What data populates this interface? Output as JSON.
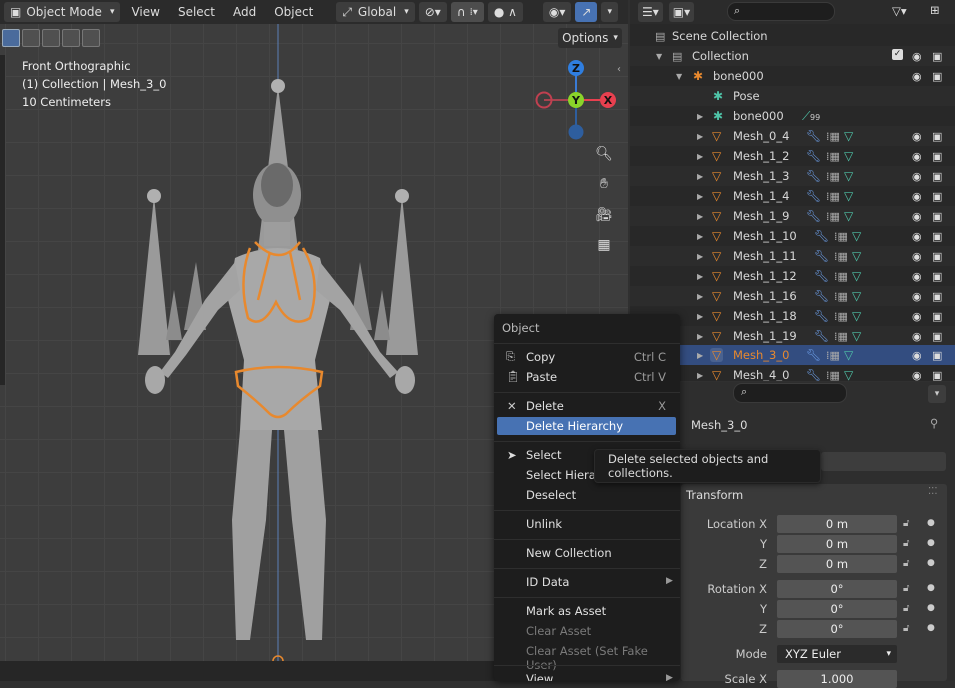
{
  "viewport": {
    "mode": "Object Mode",
    "menus": [
      "View",
      "Select",
      "Add",
      "Object"
    ],
    "orientation": "Global",
    "options": "Options",
    "info_line1": "Front Orthographic",
    "info_line2": "(1) Collection | Mesh_3_0",
    "info_line3": "10 Centimeters",
    "gizmo": {
      "z": "Z",
      "y": "Y",
      "x": "X"
    }
  },
  "outliner": {
    "rows": [
      {
        "name": "Scene Collection"
      },
      {
        "name": "Collection"
      },
      {
        "name": "bone000"
      },
      {
        "name": "Pose"
      },
      {
        "name": "bone000",
        "badge": "99"
      },
      {
        "name": "Mesh_0_4"
      },
      {
        "name": "Mesh_1_2"
      },
      {
        "name": "Mesh_1_3"
      },
      {
        "name": "Mesh_1_4"
      },
      {
        "name": "Mesh_1_9"
      },
      {
        "name": "Mesh_1_10"
      },
      {
        "name": "Mesh_1_11"
      },
      {
        "name": "Mesh_1_12"
      },
      {
        "name": "Mesh_1_16"
      },
      {
        "name": "Mesh_1_18"
      },
      {
        "name": "Mesh_1_19"
      },
      {
        "name": "Mesh_3_0"
      },
      {
        "name": "Mesh_4_0"
      }
    ]
  },
  "properties": {
    "object_name": "Mesh_3_0",
    "panel_title": "Transform",
    "loc_label": "Location X",
    "y_label": "Y",
    "z_label": "Z",
    "loc_x": "0 m",
    "loc_y": "0 m",
    "loc_z": "0 m",
    "rot_label": "Rotation X",
    "rot_x": "0°",
    "rot_y": "0°",
    "rot_z": "0°",
    "mode_label": "Mode",
    "mode_value": "XYZ Euler",
    "scale_label": "Scale X",
    "scale_x": "1.000"
  },
  "context_menu": {
    "title": "Object",
    "copy": "Copy",
    "copy_sc": "Ctrl C",
    "paste": "Paste",
    "paste_sc": "Ctrl V",
    "delete": "Delete",
    "delete_sc": "X",
    "delete_hier": "Delete Hierarchy",
    "select": "Select",
    "select_hier": "Select Hierarchy",
    "deselect": "Deselect",
    "unlink": "Unlink",
    "new_collection": "New Collection",
    "id_data": "ID Data",
    "mark_asset": "Mark as Asset",
    "clear_asset": "Clear Asset",
    "clear_asset_fake": "Clear Asset (Set Fake User)",
    "view": "View"
  },
  "tooltip": "Delete selected objects and collections.",
  "colors": {
    "accent": "#4772b3",
    "selection_orange": "#e8892e",
    "background": "#3d3d3d"
  }
}
